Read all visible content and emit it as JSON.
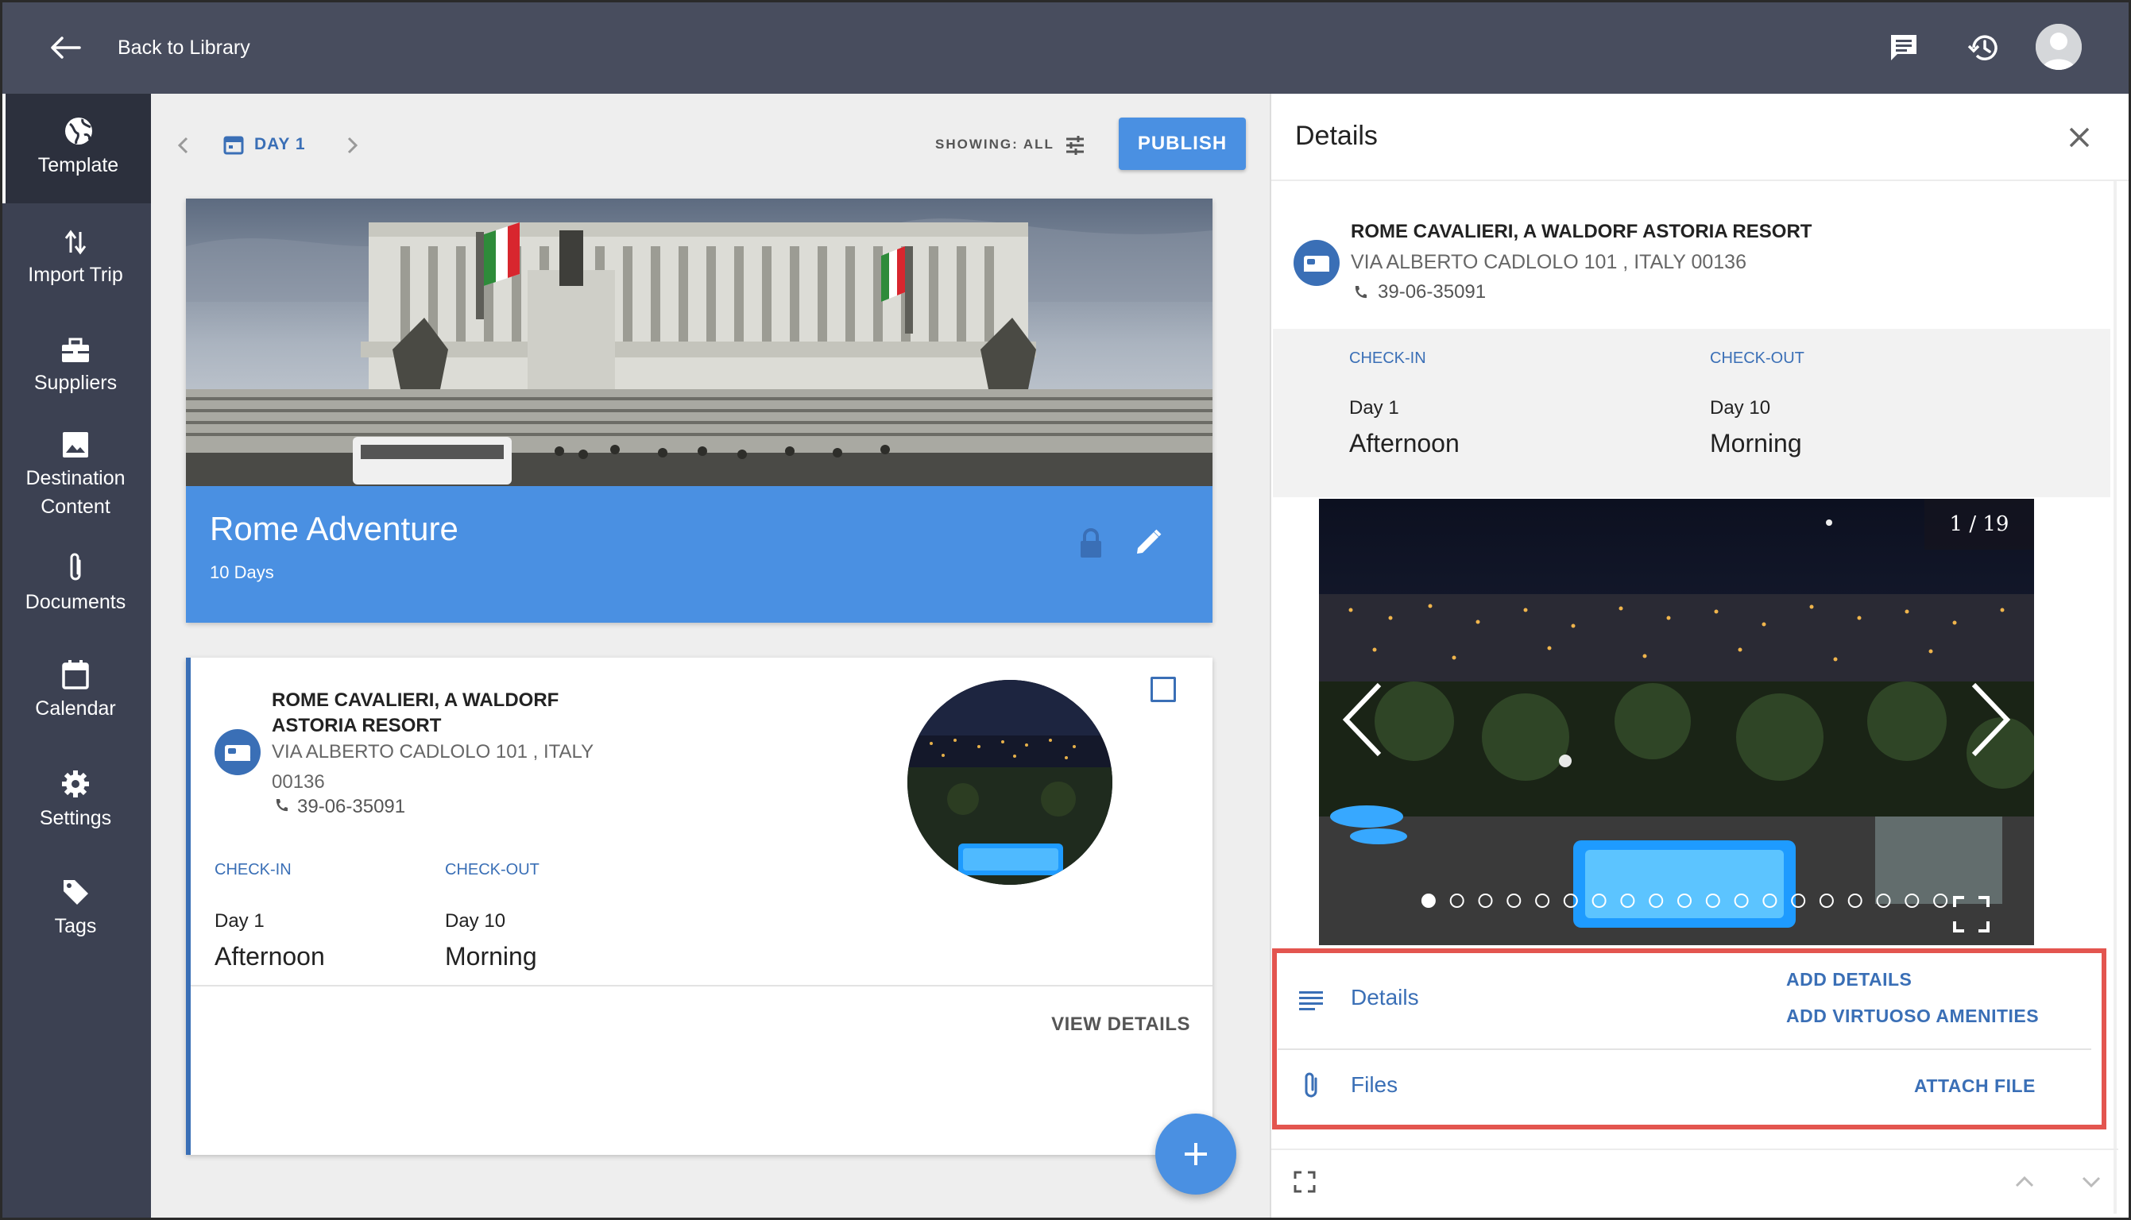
{
  "topbar": {
    "back_label": "Back to Library"
  },
  "sidebar": {
    "items": [
      {
        "label": "Template",
        "icon": "globe-icon",
        "active": true
      },
      {
        "label": "Import Trip",
        "icon": "import-arrows-icon"
      },
      {
        "label": "Suppliers",
        "icon": "briefcase-icon"
      },
      {
        "label": "Destination",
        "label2": "Content",
        "icon": "image-icon"
      },
      {
        "label": "Documents",
        "icon": "paperclip-icon"
      },
      {
        "label": "Calendar",
        "icon": "calendar-icon"
      },
      {
        "label": "Settings",
        "icon": "gear-icon"
      },
      {
        "label": "Tags",
        "icon": "tag-icon"
      }
    ]
  },
  "toolbar": {
    "day_label": "DAY 1",
    "showing_label": "SHOWING: ALL",
    "publish_label": "PUBLISH"
  },
  "trip": {
    "title": "Rome Adventure",
    "duration": "10 Days"
  },
  "hotel_card": {
    "name": "ROME CAVALIERI, A WALDORF ASTORIA RESORT",
    "address": "VIA ALBERTO CADLOLO 101 , ITALY 00136",
    "phone": "39-06-35091",
    "checkin_label": "CHECK-IN",
    "checkin_day": "Day 1",
    "checkin_time": "Afternoon",
    "checkout_label": "CHECK-OUT",
    "checkout_day": "Day 10",
    "checkout_time": "Morning",
    "view_details_label": "VIEW DETAILS"
  },
  "details_panel": {
    "title": "Details",
    "hotel_name": "ROME CAVALIERI, A WALDORF ASTORIA RESORT",
    "address": "VIA ALBERTO CADLOLO 101 , ITALY 00136",
    "phone": "39-06-35091",
    "checkin_label": "CHECK-IN",
    "checkin_day": "Day 1",
    "checkin_time": "Afternoon",
    "checkout_label": "CHECK-OUT",
    "checkout_day": "Day 10",
    "checkout_time": "Morning",
    "gallery_counter": "1 / 19",
    "gallery_current": 1,
    "gallery_total": 19,
    "details_row_label": "Details",
    "add_details_label": "ADD DETAILS",
    "add_amenities_label": "ADD VIRTUOSO AMENITIES",
    "files_row_label": "Files",
    "attach_file_label": "ATTACH FILE"
  },
  "colors": {
    "topbar": "#484d5e",
    "sidebar": "#3c4152",
    "accent": "#4a90e2",
    "link": "#3a6fb6",
    "highlight": "#e3554f"
  }
}
